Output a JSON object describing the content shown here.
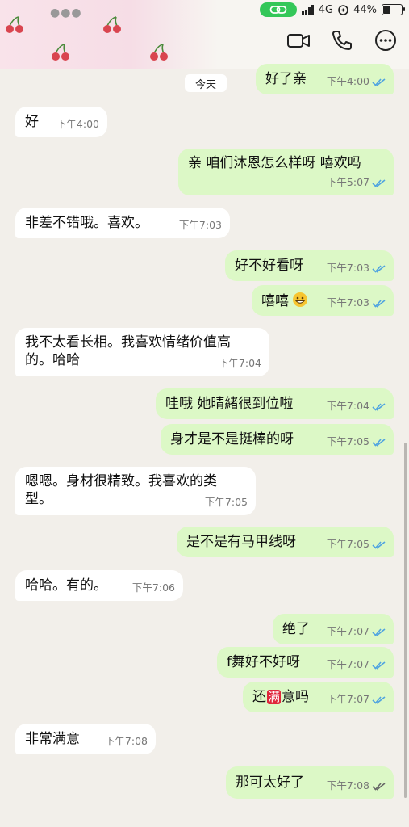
{
  "status_bar": {
    "network": "4G",
    "battery": "44%",
    "battery_level": 0.44
  },
  "header": {
    "icons": [
      "video-call-icon",
      "phone-call-icon",
      "more-options-icon"
    ]
  },
  "date_separator": "今天",
  "messages": [
    {
      "dir": "out",
      "text": "好了亲",
      "time": "下午4:00",
      "read": true
    },
    {
      "dir": "in",
      "text": "好",
      "time": "下午4:00"
    },
    {
      "dir": "out",
      "text": "亲 咱们沐恩怎么样呀 嘻欢吗",
      "time": "下午5:07",
      "read": true
    },
    {
      "dir": "in",
      "text": "非差不错哦。喜欢。",
      "time": "下午7:03"
    },
    {
      "dir": "out",
      "text": "好不好看呀",
      "time": "下午7:03",
      "read": true
    },
    {
      "dir": "out",
      "text": "嘻嘻",
      "emoji": "grin-emoji",
      "time": "下午7:03",
      "read": true
    },
    {
      "dir": "in",
      "text": "我不太看长相。我喜欢情绪价值高\n的。哈哈",
      "time": "下午7:04"
    },
    {
      "dir": "out",
      "text": "哇哦 她晴緒很到位啦",
      "time": "下午7:04",
      "read": true
    },
    {
      "dir": "out",
      "text": "身才是不是挺棒的呀",
      "time": "下午7:05",
      "read": true
    },
    {
      "dir": "in",
      "text": "嗯嗯。身材很精致。我喜欢的类\n型。",
      "time": "下午7:05"
    },
    {
      "dir": "out",
      "text": "是不是有马甲线呀",
      "time": "下午7:05",
      "read": true
    },
    {
      "dir": "in",
      "text": "哈哈。有的。",
      "time": "下午7:06"
    },
    {
      "dir": "out",
      "text": "绝了",
      "time": "下午7:07",
      "read": true
    },
    {
      "dir": "out",
      "text": "f舞好不好呀",
      "time": "下午7:07",
      "read": true
    },
    {
      "dir": "out",
      "text_before": "还",
      "badge": "满",
      "text_after": "意吗",
      "time": "下午7:07",
      "read": true
    },
    {
      "dir": "in",
      "text": "非常满意",
      "time": "下午7:08"
    },
    {
      "dir": "out",
      "text": "那可太好了",
      "time": "下午7:08",
      "read": false
    }
  ],
  "colors": {
    "outgoing": "#dcf8c6",
    "incoming": "#ffffff",
    "read_tick": "#4fa3e0",
    "background": "#f2efea"
  }
}
